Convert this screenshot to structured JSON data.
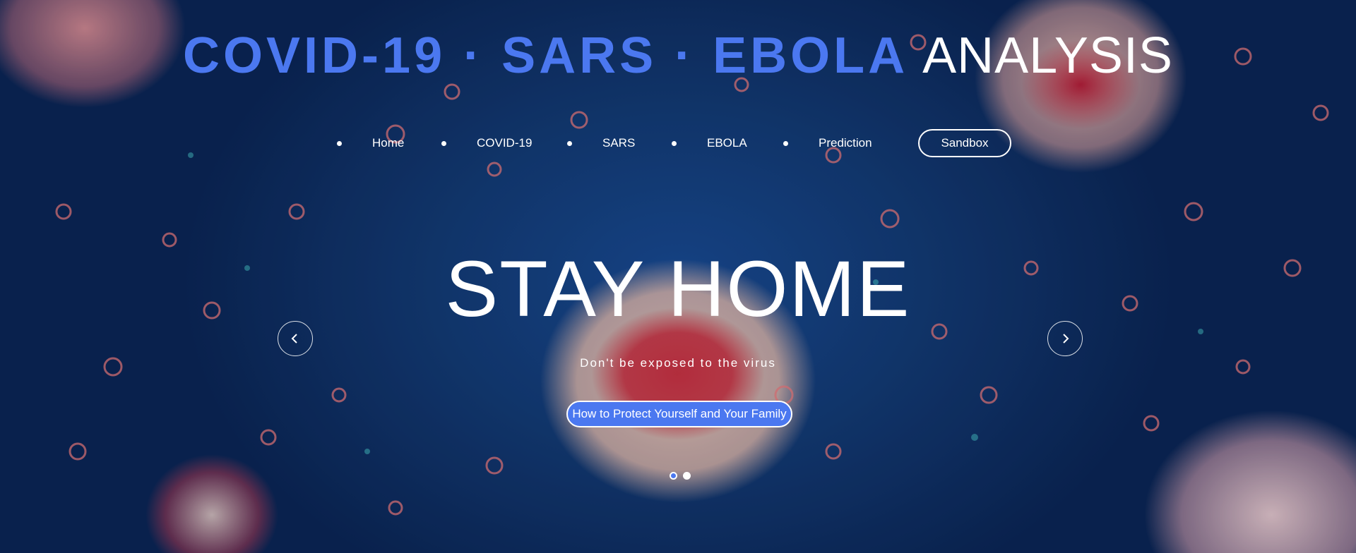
{
  "header": {
    "title_accent": "COVID-19 · SARS · EBOLA",
    "title_plain": "ANALYSIS"
  },
  "nav": {
    "items": [
      {
        "label": "Home"
      },
      {
        "label": "COVID-19"
      },
      {
        "label": "SARS"
      },
      {
        "label": "EBOLA"
      },
      {
        "label": "Prediction"
      }
    ],
    "sandbox_label": "Sandbox"
  },
  "hero": {
    "title": "STAY HOME",
    "subtitle": "Don't be exposed to the virus",
    "cta_label": "How to Protect Yourself and Your Family",
    "slide_count": 2,
    "active_slide": 1
  },
  "icons": {
    "prev": "chevron-left-icon",
    "next": "chevron-right-icon"
  },
  "colors": {
    "accent": "#4b78f0",
    "text": "#ffffff"
  }
}
